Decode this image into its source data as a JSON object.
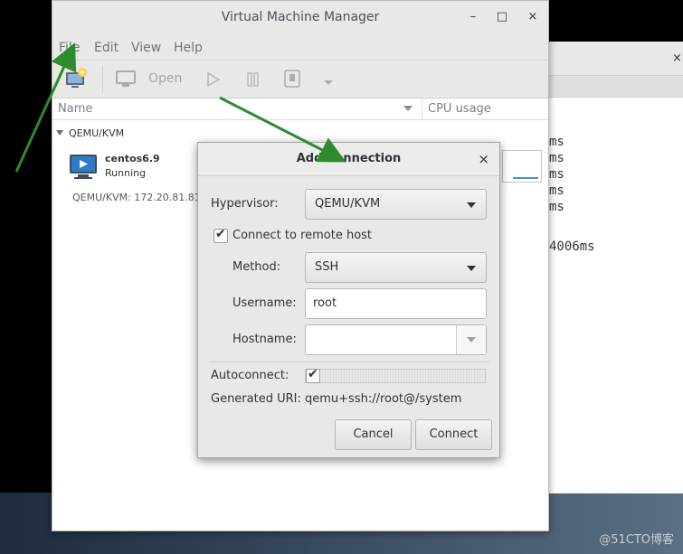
{
  "watermark": "@51CTO博客",
  "terminal": {
    "close_glyph": "×",
    "lines": [
      "ms",
      "ms",
      "ms",
      "ms",
      "ms"
    ],
    "last_line": "4006ms"
  },
  "vmm": {
    "title": "Virtual Machine Manager",
    "window_buttons": {
      "minimize": "–",
      "maximize": "□",
      "close": "×"
    },
    "menu": [
      "File",
      "Edit",
      "View",
      "Help"
    ],
    "toolbar": {
      "open_label": "Open"
    },
    "columns": {
      "name": "Name",
      "cpu": "CPU usage"
    },
    "group": "QEMU/KVM",
    "vm": {
      "name": "centos6.9",
      "state": "Running"
    },
    "connection": "QEMU/KVM: 172.20.81.81"
  },
  "dialog": {
    "title": "Add Connection",
    "close_glyph": "×",
    "hypervisor_label": "Hypervisor:",
    "hypervisor_value": "QEMU/KVM",
    "remote_label": "Connect to remote host",
    "remote_checked": true,
    "method_label": "Method:",
    "method_value": "SSH",
    "username_label": "Username:",
    "username_value": "root",
    "hostname_label": "Hostname:",
    "hostname_value": "",
    "autoconnect_label": "Autoconnect:",
    "autoconnect_checked": true,
    "uri_label": "Generated URI:",
    "uri_value": "qemu+ssh://root@/system",
    "cancel_label": "Cancel",
    "connect_label": "Connect"
  },
  "colors": {
    "arrow": "#2e8b2e",
    "accent": "#4a90d9"
  }
}
